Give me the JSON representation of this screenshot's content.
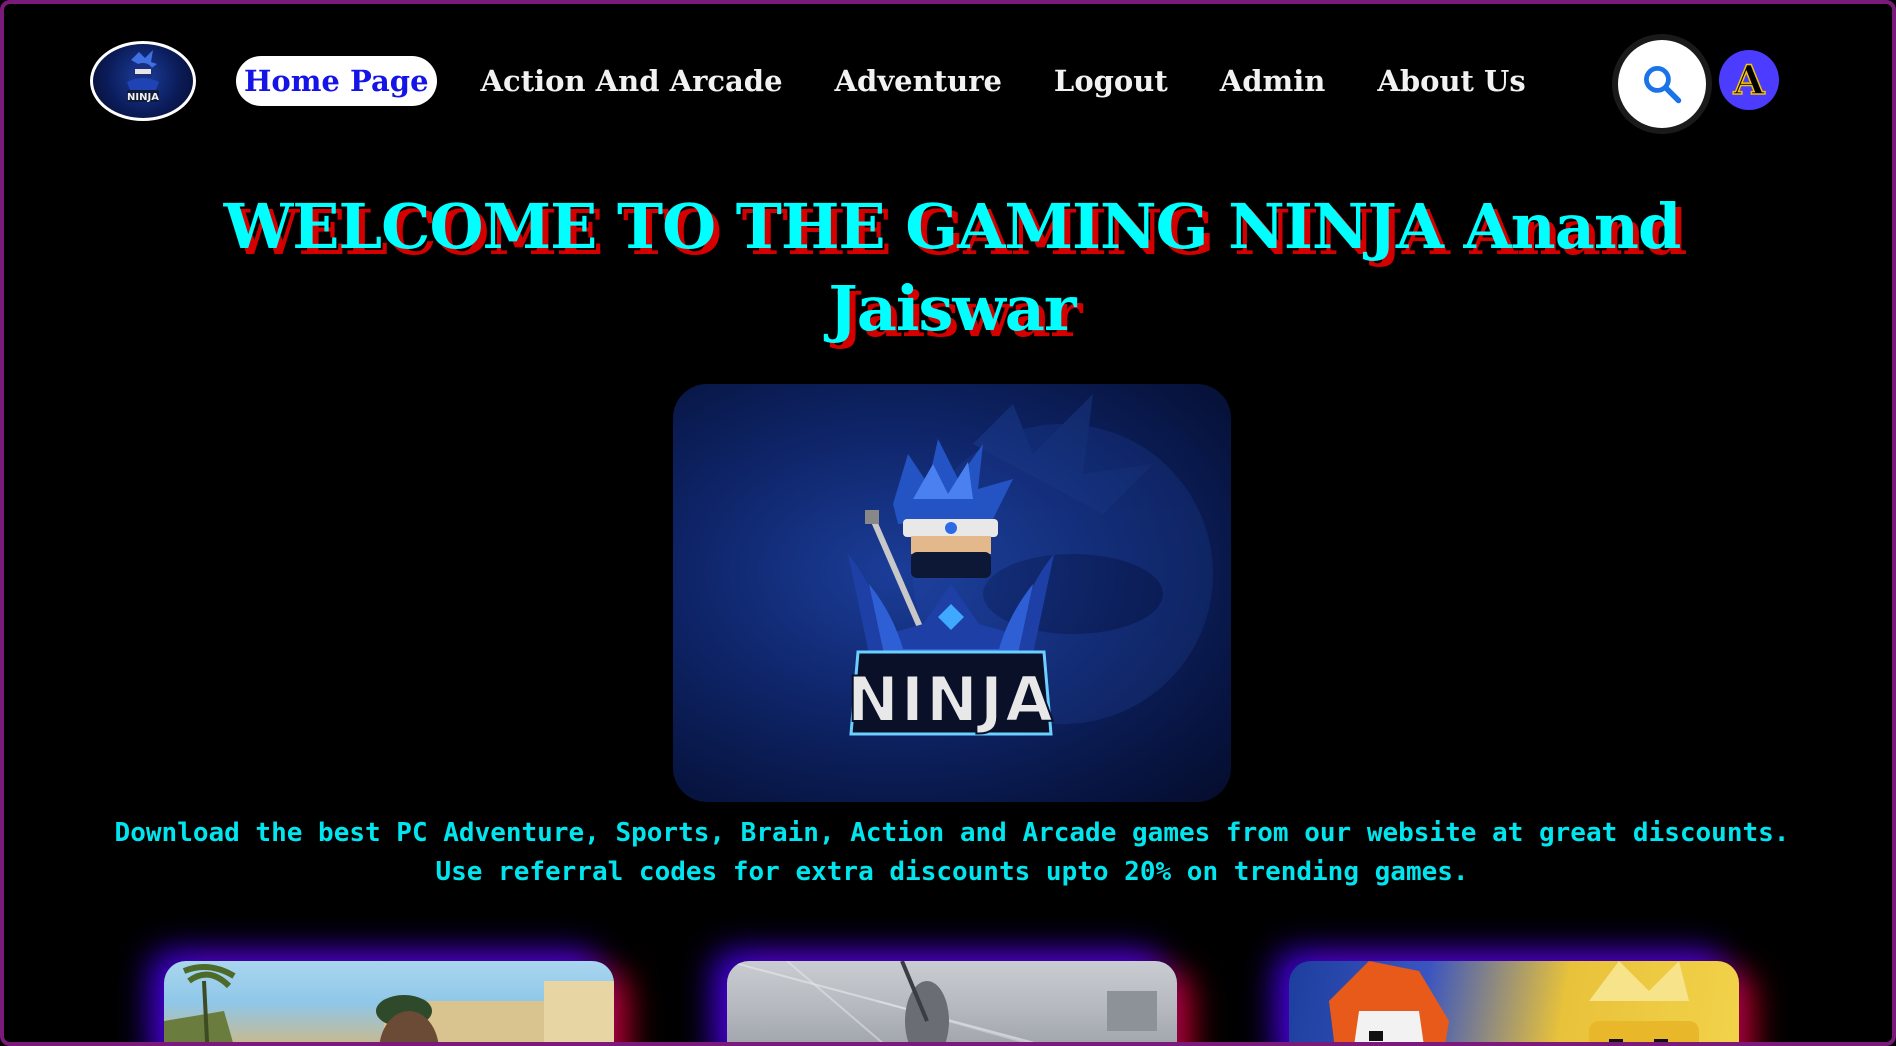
{
  "nav": {
    "logo_text": "NINJA",
    "links": [
      {
        "label": "Home Page",
        "active": true
      },
      {
        "label": "Action And Arcade",
        "active": false
      },
      {
        "label": "Adventure",
        "active": false
      },
      {
        "label": "Logout",
        "active": false
      },
      {
        "label": "Admin",
        "active": false
      },
      {
        "label": "About Us",
        "active": false
      }
    ],
    "search_icon": "search-icon",
    "avatar_letter": "A"
  },
  "hero": {
    "title": "WELCOME TO THE GAMING NINJA Anand Jaiswar",
    "image_text": "NINJA",
    "desc_line1": "Download the best PC Adventure, Sports, Brain, Action and Arcade games from our website at great discounts.",
    "desc_line2": "Use referral codes for extra discounts upto 20% on trending games."
  },
  "cards": [
    {
      "name": "game-card-1"
    },
    {
      "name": "game-card-2"
    },
    {
      "name": "game-card-3"
    }
  ],
  "colors": {
    "background": "#000000",
    "title": "#00ffff",
    "title_shadow": "#d40000",
    "active_link_text": "#1414e6",
    "border": "#7a1a7a",
    "avatar_bg": "#4b3cff"
  }
}
